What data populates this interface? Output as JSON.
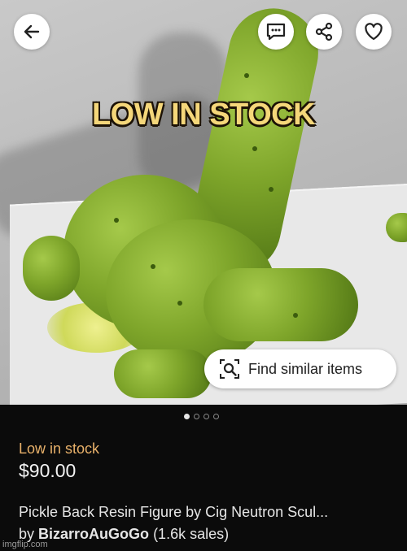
{
  "overlay": {
    "caption": "LOW IN STOCK"
  },
  "toolbar": {
    "back_icon": "arrow-left-icon",
    "message_icon": "message-icon",
    "share_icon": "share-icon",
    "favorite_icon": "heart-icon"
  },
  "find_similar": {
    "label": "Find similar items",
    "icon": "visual-search-icon"
  },
  "carousel": {
    "count": 4,
    "active_index": 0
  },
  "listing": {
    "stock_status": "Low in stock",
    "price": "$90.00",
    "title": "Pickle Back Resin Figure by Cig Neutron Scul...",
    "by_prefix": "by",
    "seller": "BizarroAuGoGo",
    "sales": "(1.6k sales)"
  },
  "watermark": "imgflip.com",
  "colors": {
    "stock_status": "#e8b16a",
    "caption_text": "#f5d77a",
    "background": "#0b0b0b"
  }
}
